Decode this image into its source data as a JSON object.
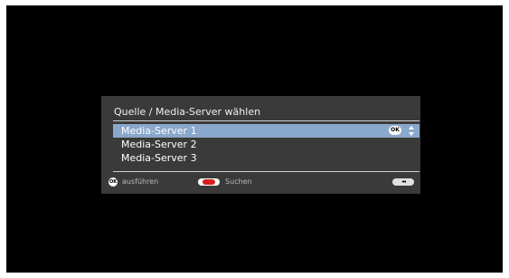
{
  "dialog": {
    "title": "Quelle / Media-Server wählen",
    "items": [
      {
        "label": "Media-Server 1",
        "selected": true
      },
      {
        "label": "Media-Server 2",
        "selected": false
      },
      {
        "label": "Media-Server 3",
        "selected": false
      }
    ],
    "ok_badge": "OK",
    "footer": {
      "ok_key": "OK",
      "execute_label": "ausführen",
      "search_label": "Suchen",
      "rewind_key": "◂◂"
    }
  },
  "colors": {
    "screen_bg": "#000000",
    "dialog_bg": "#3a3a3a",
    "selection": "#8aa7cc",
    "red_key": "#d81e1e"
  }
}
